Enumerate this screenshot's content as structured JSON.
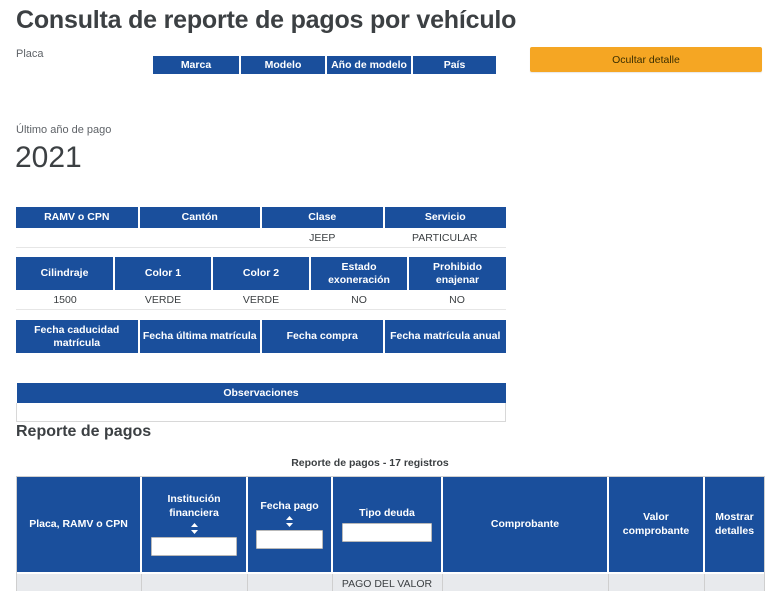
{
  "page": {
    "title": "Consulta de reporte de pagos por vehículo"
  },
  "vehicle_header": {
    "placa_label": "Placa",
    "placa_value": "",
    "columns": [
      {
        "label": "Marca",
        "value": ""
      },
      {
        "label": "Modelo",
        "value": ""
      },
      {
        "label": "Año de modelo",
        "value": ""
      },
      {
        "label": "País",
        "value": ""
      }
    ],
    "toggle_detail_button": "Ocultar detalle"
  },
  "last_payment_year": {
    "label": "Último año de pago",
    "value": "2021"
  },
  "detail_tables": [
    {
      "headers": [
        "RAMV o CPN",
        "Cantón",
        "Clase",
        "Servicio"
      ],
      "values": [
        "",
        "",
        "JEEP",
        "PARTICULAR"
      ]
    },
    {
      "headers": [
        "Cilindraje",
        "Color 1",
        "Color 2",
        "Estado exoneración",
        "Prohibido enajenar"
      ],
      "values": [
        "1500",
        "VERDE",
        "VERDE",
        "NO",
        "NO"
      ]
    },
    {
      "headers": [
        "Fecha caducidad matrícula",
        "Fecha última matrícula",
        "Fecha compra",
        "Fecha matrícula anual"
      ],
      "values": [
        "",
        "",
        "",
        ""
      ]
    }
  ],
  "observations": {
    "header": "Observaciones",
    "value": ""
  },
  "payments_section": {
    "title": "Reporte de pagos",
    "caption": "Reporte de pagos - 17 registros",
    "columns": [
      {
        "label": "Placa, RAMV o CPN",
        "sortable": false,
        "filter": false,
        "filter_value": "",
        "filter_placeholder": ""
      },
      {
        "label": "Institución financiera",
        "sortable": true,
        "sort_icon": "sort-updown-icon",
        "filter": true,
        "filter_value": "",
        "filter_placeholder": ""
      },
      {
        "label": "Fecha pago",
        "sortable": true,
        "sort_icon": "sort-updown-icon",
        "filter": true,
        "filter_value": "",
        "filter_placeholder": ""
      },
      {
        "label": "Tipo deuda",
        "sortable": false,
        "filter": true,
        "filter_value": "",
        "filter_placeholder": ""
      },
      {
        "label": "Comprobante",
        "sortable": false,
        "filter": false,
        "filter_value": "",
        "filter_placeholder": ""
      },
      {
        "label": "Valor comprobante",
        "sortable": false,
        "filter": false,
        "filter_value": "",
        "filter_placeholder": ""
      },
      {
        "label": "Mostrar detalles",
        "sortable": false,
        "filter": false,
        "filter_value": "",
        "filter_placeholder": ""
      }
    ],
    "rows": [
      {
        "placa": "",
        "institucion": "",
        "fecha_pago": "",
        "tipo_deuda": "PAGO DEL VALOR",
        "comprobante": "",
        "valor_comprobante": "",
        "mostrar_detalles": ""
      }
    ]
  },
  "colors": {
    "header_blue": "#1a4f9c",
    "accent_orange": "#f5a623",
    "row_gray": "#e8eaed",
    "text_dark": "#3c4043",
    "text_muted": "#5f6368"
  }
}
